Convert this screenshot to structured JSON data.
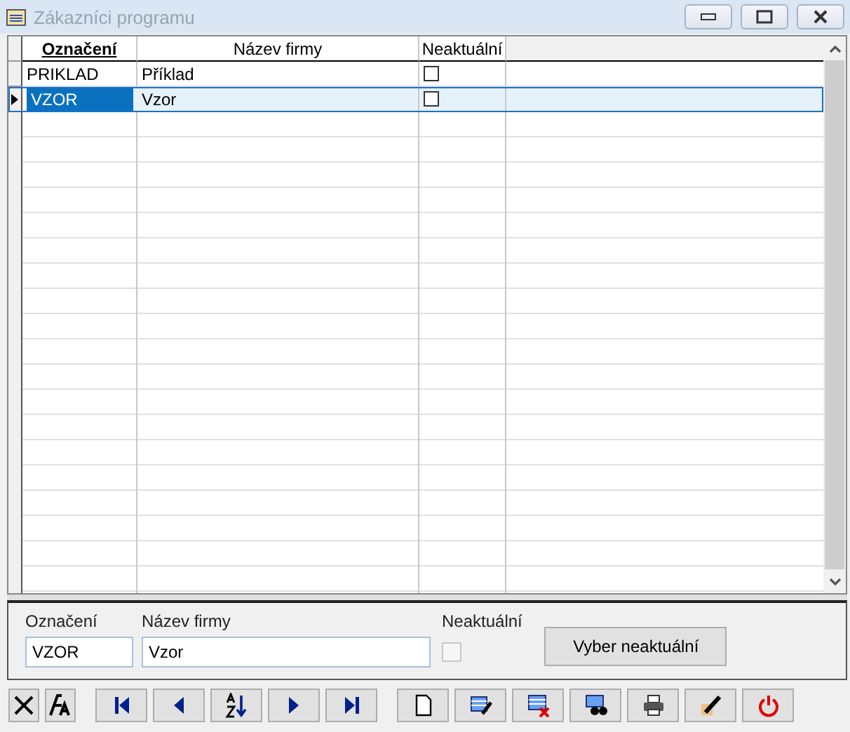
{
  "window": {
    "title": "Zákazníci programu"
  },
  "table": {
    "columns": [
      {
        "label": "Označení",
        "sorted": true
      },
      {
        "label": "Název firmy",
        "sorted": false
      },
      {
        "label": "Neaktuální",
        "sorted": false
      }
    ],
    "rows": [
      {
        "code": "PRIKLAD",
        "name": "Příklad",
        "inactive": false,
        "selected": false
      },
      {
        "code": "VZOR",
        "name": "Vzor",
        "inactive": false,
        "selected": true
      }
    ]
  },
  "detail": {
    "code_label": "Označení",
    "code_value": "VZOR",
    "name_label": "Název firmy",
    "name_value": "Vzor",
    "inactive_label": "Neaktuální",
    "inactive_checked": false,
    "inactive_disabled": true,
    "button": "Vyber neaktuální"
  },
  "toolbar": [
    {
      "kind": "cancel"
    },
    {
      "kind": "font"
    },
    {
      "kind": "first"
    },
    {
      "kind": "prev"
    },
    {
      "kind": "sort"
    },
    {
      "kind": "next"
    },
    {
      "kind": "last"
    },
    {
      "kind": "new"
    },
    {
      "kind": "edit"
    },
    {
      "kind": "delete"
    },
    {
      "kind": "find"
    },
    {
      "kind": "print"
    },
    {
      "kind": "tools"
    },
    {
      "kind": "power"
    }
  ]
}
